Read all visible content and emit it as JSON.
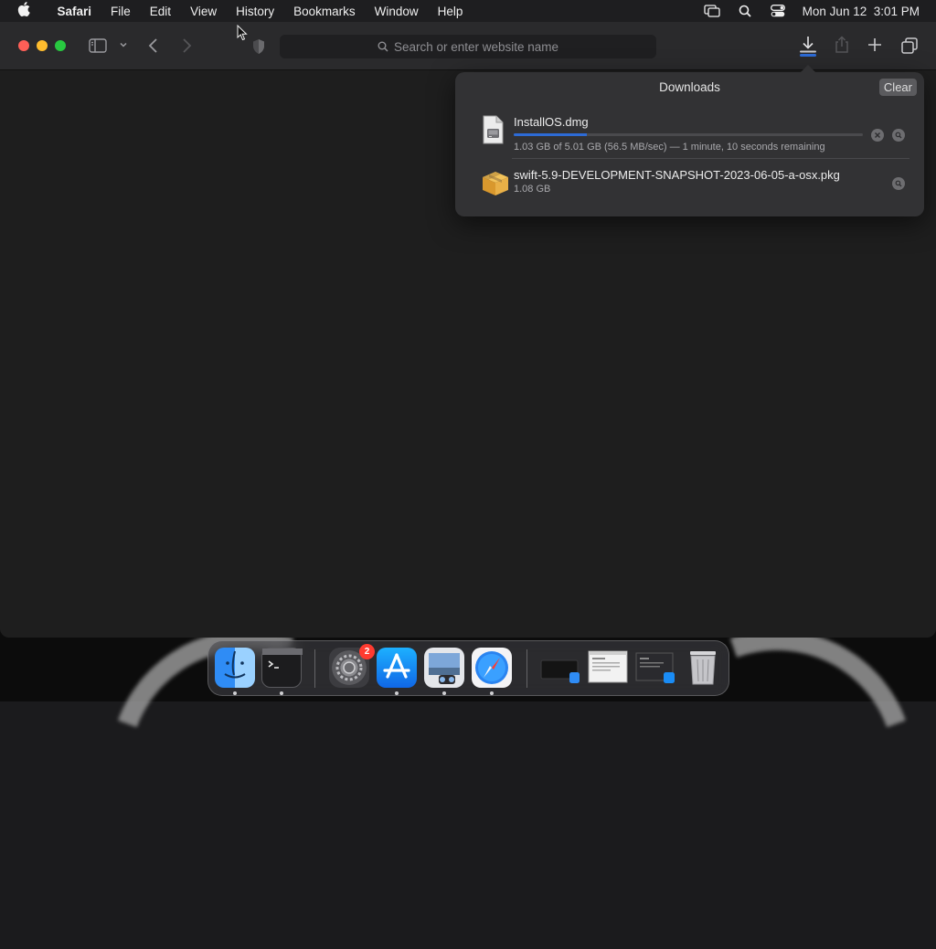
{
  "menubar": {
    "app_name": "Safari",
    "items": [
      "File",
      "Edit",
      "View",
      "History",
      "Bookmarks",
      "Window",
      "Help"
    ],
    "clock": "Mon Jun 12  3:01 PM",
    "status_icons": [
      "screen-mirroring-icon",
      "spotlight-search-icon",
      "control-center-icon"
    ]
  },
  "toolbar": {
    "search_placeholder": "Search or enter website name"
  },
  "downloads": {
    "title": "Downloads",
    "clear_label": "Clear",
    "items": [
      {
        "name": "InstallOS.dmg",
        "status": "1.03 GB of 5.01 GB (56.5 MB/sec) — 1 minute, 10 seconds remaining",
        "progress": 0.21,
        "icon": "disk-image-icon"
      },
      {
        "name": "swift-5.9-DEVELOPMENT-SNAPSHOT-2023-06-05-a-osx.pkg",
        "status": "1.08 GB",
        "icon": "package-icon"
      }
    ]
  },
  "dock": {
    "apps": [
      "Finder",
      "Terminal",
      "System Settings",
      "App Store",
      "Preview",
      "Safari"
    ],
    "system_settings_badge": "2"
  },
  "colors": {
    "progress_fill": "#2d6bd6",
    "close_button": "#ff5f57",
    "minimize_button": "#febc2e",
    "zoom_button": "#28c840"
  }
}
